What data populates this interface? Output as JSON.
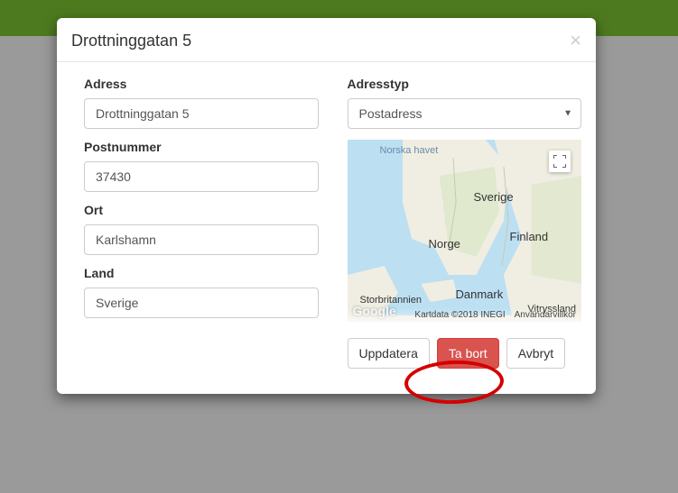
{
  "modal": {
    "title": "Drottninggatan 5",
    "close_label": "×"
  },
  "left": {
    "address_label": "Adress",
    "address_value": "Drottninggatan 5",
    "postal_label": "Postnummer",
    "postal_value": "37430",
    "city_label": "Ort",
    "city_value": "Karlshamn",
    "country_label": "Land",
    "country_value": "Sverige"
  },
  "right": {
    "type_label": "Adresstyp",
    "type_value": "Postadress"
  },
  "map": {
    "sea_label": "Norska havet",
    "countries": {
      "sverige": "Sverige",
      "norge": "Norge",
      "finland": "Finland",
      "danmark": "Danmark",
      "storbritannien": "Storbritannien",
      "vitryssland": "Vitryssland"
    },
    "google": "Google",
    "attrib_data": "Kartdata ©2018 INEGI",
    "attrib_terms": "Användarvillkor"
  },
  "buttons": {
    "update": "Uppdatera",
    "delete": "Ta bort",
    "cancel": "Avbryt"
  }
}
